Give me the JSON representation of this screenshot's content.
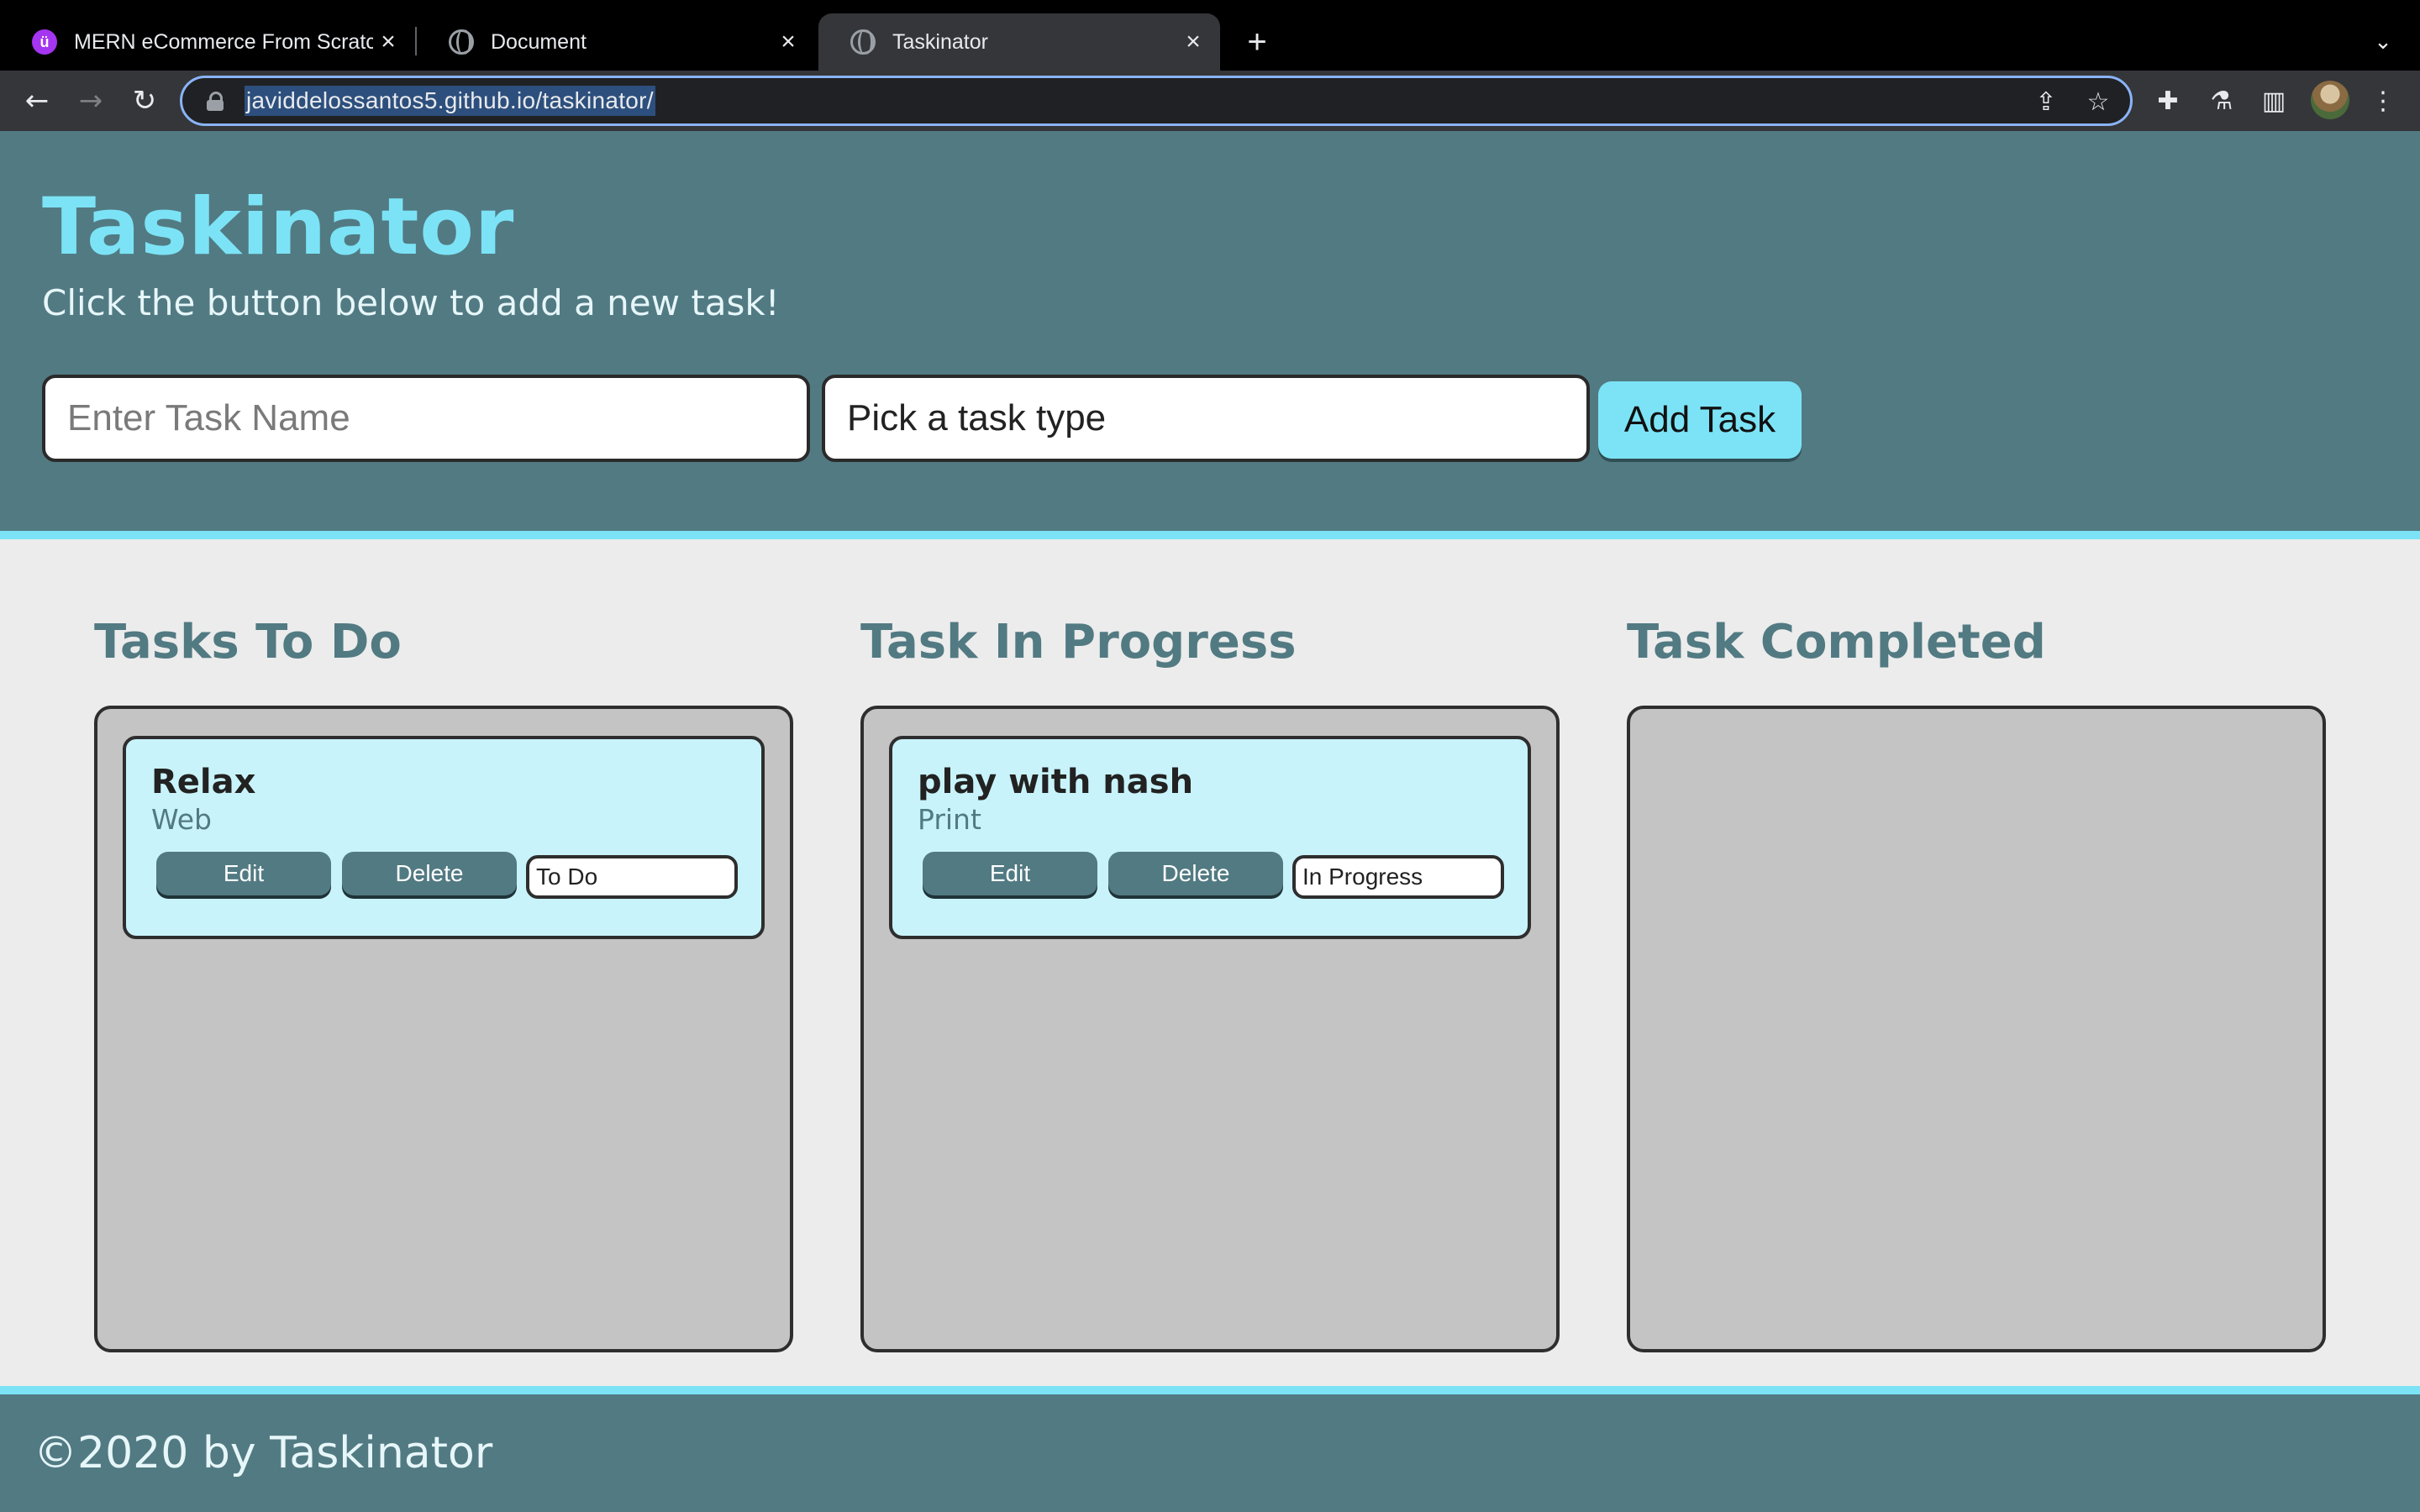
{
  "browser": {
    "tabs": [
      {
        "title": "MERN eCommerce From Scratc",
        "icon": "udemy-icon",
        "active": false
      },
      {
        "title": "Document",
        "icon": "globe-icon",
        "active": false
      },
      {
        "title": "Taskinator",
        "icon": "globe-icon",
        "active": true
      }
    ],
    "new_tab_glyph": "+",
    "url": "javiddelossantos5.github.io/taskinator/"
  },
  "header": {
    "title": "Taskinator",
    "subtitle": "Click the button below to add a new task!",
    "task_name_placeholder": "Enter Task Name",
    "task_type_value": "Pick a task type",
    "add_button": "Add Task"
  },
  "columns": [
    {
      "title": "Tasks To Do",
      "tasks": [
        {
          "name": "Relax",
          "type": "Web",
          "edit": "Edit",
          "delete": "Delete",
          "status": "To Do"
        }
      ]
    },
    {
      "title": "Task In Progress",
      "tasks": [
        {
          "name": "play with nash",
          "type": "Print",
          "edit": "Edit",
          "delete": "Delete",
          "status": "In Progress"
        }
      ]
    },
    {
      "title": "Task Completed",
      "tasks": []
    }
  ],
  "footer": {
    "text": "©2020 by Taskinator"
  },
  "colors": {
    "header_bg": "#527a82",
    "accent": "#7ce3f6",
    "card_bg": "#c9f3fb",
    "column_bg": "#c4c4c4",
    "page_bg": "#ececec"
  }
}
